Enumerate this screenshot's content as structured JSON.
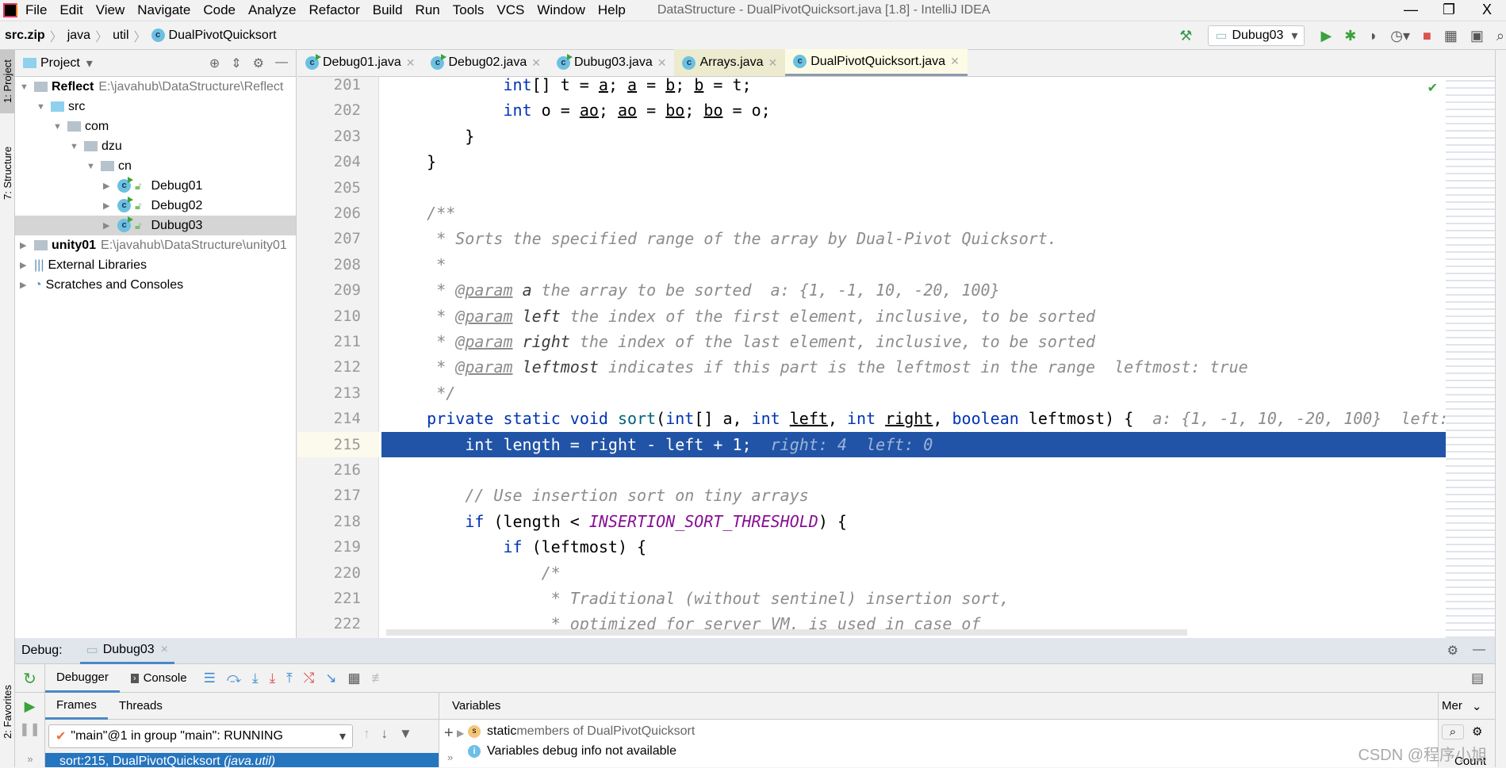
{
  "window": {
    "title": "DataStructure - DualPivotQuicksort.java [1.8] - IntelliJ IDEA",
    "controls": [
      "—",
      "❐",
      "X"
    ]
  },
  "menu": [
    "File",
    "Edit",
    "View",
    "Navigate",
    "Code",
    "Analyze",
    "Refactor",
    "Build",
    "Run",
    "Tools",
    "VCS",
    "Window",
    "Help"
  ],
  "breadcrumb": [
    "src.zip",
    "java",
    "util",
    "DualPivotQuicksort"
  ],
  "run_config": "Dubug03",
  "side_tabs": {
    "project": "1: Project",
    "structure": "7: Structure",
    "favorites": "2: Favorites"
  },
  "project": {
    "title": "Project",
    "tree": [
      {
        "label": "Reflect",
        "path": "E:\\javahub\\DataStructure\\Reflect",
        "depth": 0,
        "open": true,
        "bold": true,
        "icon": "module-folder"
      },
      {
        "label": "src",
        "depth": 1,
        "open": true,
        "icon": "source-folder"
      },
      {
        "label": "com",
        "depth": 2,
        "open": true,
        "icon": "package-folder"
      },
      {
        "label": "dzu",
        "depth": 3,
        "open": true,
        "icon": "package-folder"
      },
      {
        "label": "cn",
        "depth": 4,
        "open": true,
        "icon": "package-folder"
      },
      {
        "label": "Debug01",
        "depth": 5,
        "open": false,
        "icon": "java-class"
      },
      {
        "label": "Debug02",
        "depth": 5,
        "open": false,
        "icon": "java-class"
      },
      {
        "label": "Dubug03",
        "depth": 5,
        "open": false,
        "icon": "java-class",
        "selected": true
      },
      {
        "label": "unity01",
        "path": "E:\\javahub\\DataStructure\\unity01",
        "depth": 0,
        "open": false,
        "bold": true,
        "icon": "module-folder"
      },
      {
        "label": "External Libraries",
        "depth": 0,
        "open": false,
        "icon": "libraries"
      },
      {
        "label": "Scratches and Consoles",
        "depth": 0,
        "open": false,
        "icon": "scratches"
      }
    ]
  },
  "editor_tabs": [
    {
      "label": "Debug01.java"
    },
    {
      "label": "Debug02.java"
    },
    {
      "label": "Dubug03.java"
    },
    {
      "label": "Arrays.java"
    },
    {
      "label": "DualPivotQuicksort.java",
      "active": true
    }
  ],
  "code": {
    "current_line": 215,
    "lines": [
      {
        "n": 201,
        "indent": 12,
        "tokens": [
          [
            "int",
            "kw"
          ],
          [
            "[] t = ",
            "plain"
          ],
          [
            "a",
            "u"
          ],
          [
            "; ",
            "plain"
          ],
          [
            "a",
            "u"
          ],
          [
            " = ",
            "plain"
          ],
          [
            "b",
            "u"
          ],
          [
            "; ",
            "plain"
          ],
          [
            "b",
            "u"
          ],
          [
            " = t;",
            "plain"
          ]
        ]
      },
      {
        "n": 202,
        "indent": 12,
        "tokens": [
          [
            "int",
            "kw"
          ],
          [
            " o = ",
            "plain"
          ],
          [
            "ao",
            "u"
          ],
          [
            "; ",
            "plain"
          ],
          [
            "ao",
            "u"
          ],
          [
            " = ",
            "plain"
          ],
          [
            "bo",
            "u"
          ],
          [
            "; ",
            "plain"
          ],
          [
            "bo",
            "u"
          ],
          [
            " = o;",
            "plain"
          ]
        ]
      },
      {
        "n": 203,
        "indent": 8,
        "tokens": [
          [
            "}",
            "plain"
          ]
        ]
      },
      {
        "n": 204,
        "indent": 4,
        "tokens": [
          [
            "}",
            "plain"
          ]
        ]
      },
      {
        "n": 205,
        "indent": 0,
        "tokens": []
      },
      {
        "n": 206,
        "indent": 4,
        "tokens": [
          [
            "/**",
            "c"
          ]
        ]
      },
      {
        "n": 207,
        "indent": 5,
        "tokens": [
          [
            "* Sorts the specified range of the array by Dual-Pivot Quicksort.",
            "c"
          ]
        ]
      },
      {
        "n": 208,
        "indent": 5,
        "tokens": [
          [
            "*",
            "c"
          ]
        ]
      },
      {
        "n": 209,
        "indent": 5,
        "tokens": [
          [
            "* ",
            "c"
          ],
          [
            "@param",
            "tag"
          ],
          [
            " ",
            "c"
          ],
          [
            "a",
            "pn"
          ],
          [
            " the array to be sorted  ",
            "c"
          ],
          [
            "a: {1, -1, 10, -20, 100}",
            "hint"
          ]
        ]
      },
      {
        "n": 210,
        "indent": 5,
        "tokens": [
          [
            "* ",
            "c"
          ],
          [
            "@param",
            "tag"
          ],
          [
            " ",
            "c"
          ],
          [
            "left",
            "pn"
          ],
          [
            " the index of the first element, inclusive, to be sorted",
            "c"
          ]
        ]
      },
      {
        "n": 211,
        "indent": 5,
        "tokens": [
          [
            "* ",
            "c"
          ],
          [
            "@param",
            "tag"
          ],
          [
            " ",
            "c"
          ],
          [
            "right",
            "pn"
          ],
          [
            " the index of the last element, inclusive, to be sorted",
            "c"
          ]
        ]
      },
      {
        "n": 212,
        "indent": 5,
        "tokens": [
          [
            "* ",
            "c"
          ],
          [
            "@param",
            "tag"
          ],
          [
            " ",
            "c"
          ],
          [
            "leftmost",
            "pn"
          ],
          [
            " indicates if this part is the leftmost in the range  ",
            "c"
          ],
          [
            "leftmost: true",
            "hint"
          ]
        ]
      },
      {
        "n": 213,
        "indent": 5,
        "tokens": [
          [
            "*/",
            "c"
          ]
        ]
      },
      {
        "n": 214,
        "indent": 4,
        "tokens": [
          [
            "private static void ",
            "kw"
          ],
          [
            "sort",
            "m"
          ],
          [
            "(",
            "plain"
          ],
          [
            "int",
            "kw"
          ],
          [
            "[] a, ",
            "plain"
          ],
          [
            "int",
            "kw"
          ],
          [
            " ",
            "plain"
          ],
          [
            "left",
            "u"
          ],
          [
            ", ",
            "plain"
          ],
          [
            "int",
            "kw"
          ],
          [
            " ",
            "plain"
          ],
          [
            "right",
            "u"
          ],
          [
            ", ",
            "plain"
          ],
          [
            "boolean",
            "kw"
          ],
          [
            " leftmost) {  ",
            "plain"
          ],
          [
            "a: {1, -1, 10, -20, 100}  left:",
            "hint"
          ]
        ]
      },
      {
        "n": 215,
        "indent": 8,
        "tokens": [
          [
            "int length = right - left + 1;  ",
            "plain"
          ],
          [
            "right: 4  left: 0",
            "hint"
          ]
        ]
      },
      {
        "n": 216,
        "indent": 0,
        "tokens": []
      },
      {
        "n": 217,
        "indent": 8,
        "tokens": [
          [
            "// Use insertion sort on tiny arrays",
            "c"
          ]
        ]
      },
      {
        "n": 218,
        "indent": 8,
        "tokens": [
          [
            "if",
            "kw"
          ],
          [
            " (length < ",
            "plain"
          ],
          [
            "INSERTION_SORT_THRESHOLD",
            "const"
          ],
          [
            ") {",
            "plain"
          ]
        ]
      },
      {
        "n": 219,
        "indent": 12,
        "tokens": [
          [
            "if",
            "kw"
          ],
          [
            " (leftmost) {",
            "plain"
          ]
        ]
      },
      {
        "n": 220,
        "indent": 16,
        "tokens": [
          [
            "/*",
            "c"
          ]
        ]
      },
      {
        "n": 221,
        "indent": 17,
        "tokens": [
          [
            "* Traditional (without sentinel) insertion sort,",
            "c"
          ]
        ]
      },
      {
        "n": 222,
        "indent": 17,
        "tokens": [
          [
            "* optimized for server VM, is used in case of",
            "c"
          ]
        ]
      }
    ]
  },
  "debug": {
    "label": "Debug:",
    "session": "Dubug03",
    "tabs": [
      "Debugger",
      "Console"
    ],
    "frames_tabs": [
      "Frames",
      "Threads"
    ],
    "variables_label": "Variables",
    "thread": "\"main\"@1 in group \"main\": RUNNING",
    "frame": {
      "method": "sort:215, DualPivotQuicksort",
      "pkg": "(java.util)"
    },
    "variables": [
      {
        "icon": "static-icon",
        "key": "static",
        "rest": " members of DualPivotQuicksort"
      },
      {
        "icon": "info-icon",
        "key": "",
        "rest": "Variables debug info not available"
      }
    ],
    "memory_tab": "Mer",
    "count_label": "Count"
  },
  "watermark": "CSDN @程序小旭",
  "colors": {
    "highlight": "#2154a6",
    "keyword": "#0033b3",
    "frame_selected": "#2675bf"
  }
}
